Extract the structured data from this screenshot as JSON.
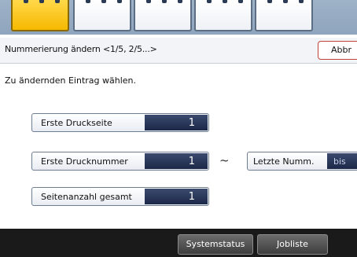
{
  "tabs": [
    {
      "state": "active"
    },
    {
      "state": "inactive"
    },
    {
      "state": "inactive"
    },
    {
      "state": "inactive"
    },
    {
      "state": "inactive"
    }
  ],
  "header": {
    "title": "Nummerierung ändern <1/5, 2/5...>",
    "abort_label": "Abbr"
  },
  "instruction": "Zu ändernden Eintrag wählen.",
  "fields": {
    "first_print_page": {
      "label": "Erste Druckseite",
      "value": "1"
    },
    "first_print_number": {
      "label": "Erste Drucknummer",
      "value": "1"
    },
    "total_pages": {
      "label": "Seitenanzahl gesamt",
      "value": "1"
    }
  },
  "range_separator": "~",
  "last_number": {
    "label": "Letzte Numm.",
    "value": "bis"
  },
  "bottom_bar": {
    "system_status_label": "Systemstatus",
    "job_list_label": "Jobliste"
  },
  "colors": {
    "active_tab": "#f6b900",
    "value_box": "#1c2848",
    "abort_border": "#c2413b",
    "bottom_bar": "#1a1a1a"
  }
}
